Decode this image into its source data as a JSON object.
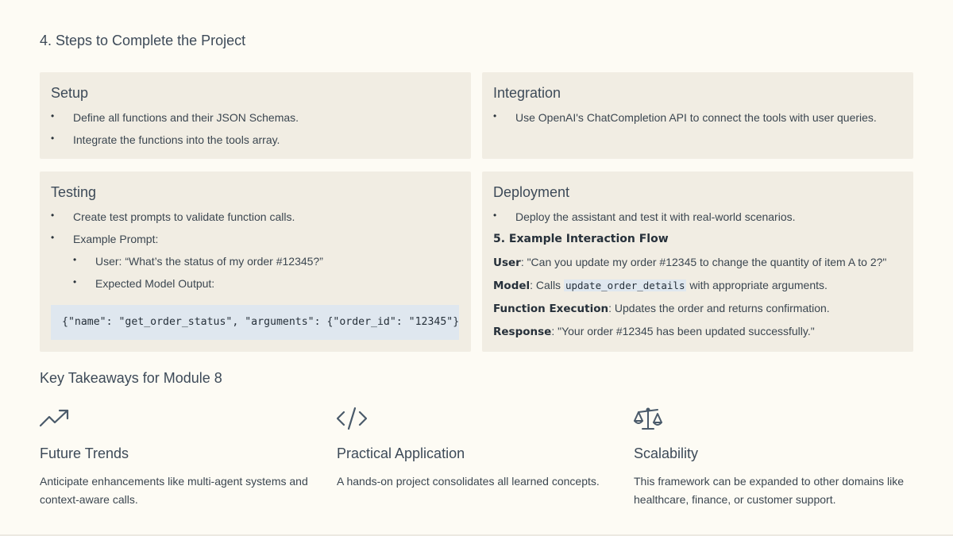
{
  "steps": {
    "title": "4. Steps to Complete the Project",
    "setup": {
      "title": "Setup",
      "items": [
        "Define all functions and their JSON Schemas.",
        "Integrate the functions into the tools array."
      ]
    },
    "integration": {
      "title": "Integration",
      "items": [
        "Use OpenAI's ChatCompletion API to connect the tools with user queries."
      ]
    },
    "testing": {
      "title": "Testing",
      "items": [
        "Create test prompts to validate function calls.",
        "Example Prompt:"
      ],
      "sub_items": [
        "User: “What’s the status of my order #12345?”",
        "Expected Model Output:"
      ],
      "code": "{\"name\": \"get_order_status\", \"arguments\": {\"order_id\": \"12345\"}}"
    },
    "deployment": {
      "title": "Deployment",
      "items": [
        "Deploy the assistant and test it with real-world scenarios."
      ],
      "flow_title": "5. Example Interaction Flow",
      "flow": {
        "user_label": "User",
        "user_text": ": \"Can you update my order #12345 to change the quantity of item A to 2?\"",
        "model_label": "Model",
        "model_pre": ": Calls ",
        "model_code": "update_order_details",
        "model_post": " with appropriate arguments.",
        "exec_label": "Function Execution",
        "exec_text": ": Updates the order and returns confirmation.",
        "resp_label": "Response",
        "resp_text": ": \"Your order #12345 has been updated successfully.\""
      }
    }
  },
  "takeaways": {
    "title": "Key Takeaways for Module 8",
    "items": [
      {
        "icon": "trending-up-icon",
        "title": "Future Trends",
        "text": "Anticipate enhancements like multi-agent systems and context-aware calls."
      },
      {
        "icon": "code-icon",
        "title": "Practical Application",
        "text": "A hands-on project consolidates all learned concepts."
      },
      {
        "icon": "scale-icon",
        "title": "Scalability",
        "text": "This framework can be expanded to other domains like healthcare, finance, or customer support."
      }
    ]
  },
  "colors": {
    "background": "#fdfbf4",
    "card": "#f1ede3",
    "code_bg": "#dfe7ef",
    "heading": "#3d4a58",
    "icon": "#4a5a6a"
  }
}
